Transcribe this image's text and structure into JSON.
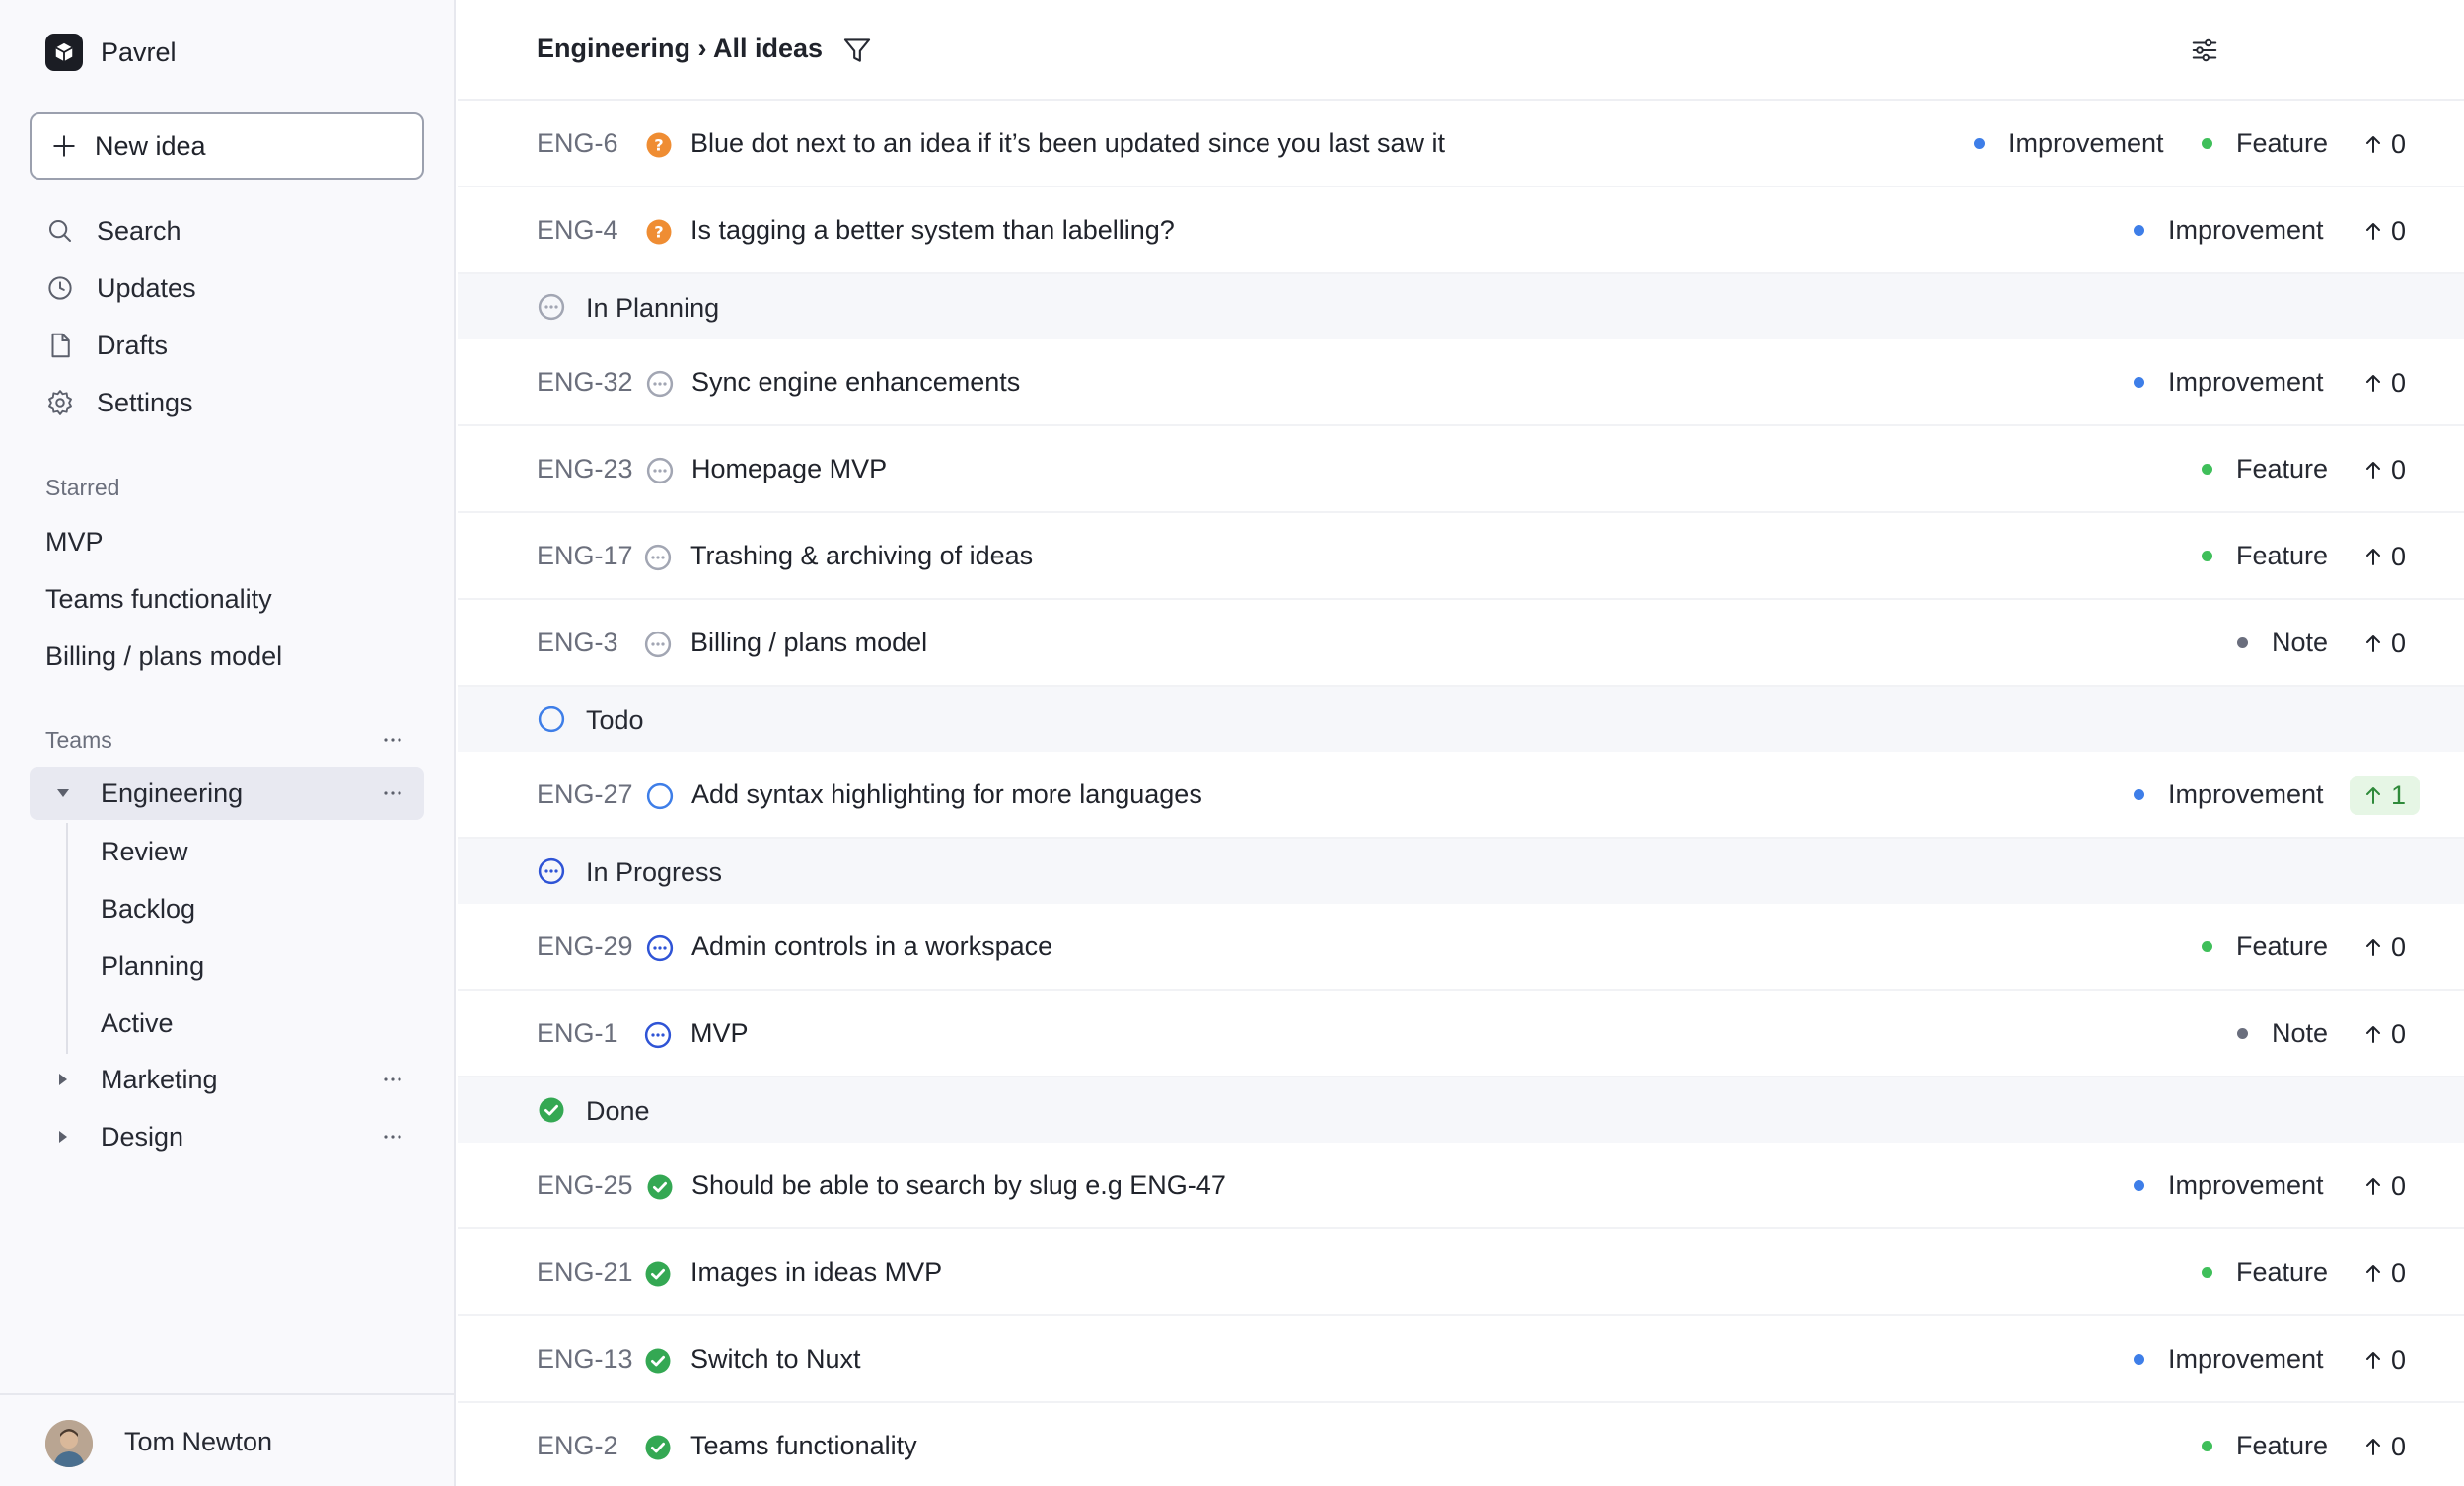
{
  "workspace": {
    "name": "Pavrel"
  },
  "sidebar": {
    "new_idea_label": "New idea",
    "nav": [
      {
        "label": "Search",
        "icon": "search-icon"
      },
      {
        "label": "Updates",
        "icon": "clock-icon"
      },
      {
        "label": "Drafts",
        "icon": "document-icon"
      },
      {
        "label": "Settings",
        "icon": "gear-icon"
      }
    ],
    "starred_title": "Starred",
    "starred": [
      "MVP",
      "Teams functionality",
      "Billing / plans model"
    ],
    "teams_title": "Teams",
    "teams": [
      {
        "label": "Engineering",
        "expanded": true,
        "active": true
      },
      {
        "label": "Marketing",
        "expanded": false,
        "active": false
      },
      {
        "label": "Design",
        "expanded": false,
        "active": false
      }
    ],
    "engineering_views": [
      "Review",
      "Backlog",
      "Planning",
      "Active"
    ],
    "user": {
      "name": "Tom Newton"
    }
  },
  "header": {
    "breadcrumb_team": "Engineering",
    "breadcrumb_sep": " › ",
    "breadcrumb_view": "All ideas"
  },
  "colors": {
    "improvement": "#3e7ee8",
    "feature": "#3fbf5a",
    "note": "#6a6e7d",
    "review_status": "#ef8d33",
    "planning_status": "#a2a6b3",
    "todo_status": "#3e7ee8",
    "progress_status": "#2f54d6",
    "done_status": "#34a853"
  },
  "groups": {
    "planning": "In Planning",
    "todo": "Todo",
    "progress": "In Progress",
    "done": "Done"
  },
  "ideas": [
    {
      "slug": "ENG-6",
      "title": "Blue dot next to an idea if it’s been updated since you last saw it",
      "labels": [
        "Improvement",
        "Feature"
      ],
      "votes": "0"
    },
    {
      "slug": "ENG-4",
      "title": "Is tagging a better system than labelling?",
      "labels": [
        "Improvement"
      ],
      "votes": "0"
    },
    {
      "slug": "ENG-32",
      "title": "Sync engine enhancements",
      "labels": [
        "Improvement"
      ],
      "votes": "0"
    },
    {
      "slug": "ENG-23",
      "title": "Homepage MVP",
      "labels": [
        "Feature"
      ],
      "votes": "0"
    },
    {
      "slug": "ENG-17",
      "title": "Trashing & archiving of ideas",
      "labels": [
        "Feature"
      ],
      "votes": "0"
    },
    {
      "slug": "ENG-3",
      "title": "Billing / plans model",
      "labels": [
        "Note"
      ],
      "votes": "0"
    },
    {
      "slug": "ENG-27",
      "title": "Add syntax highlighting for more languages",
      "labels": [
        "Improvement"
      ],
      "votes": "1"
    },
    {
      "slug": "ENG-29",
      "title": "Admin controls in a workspace",
      "labels": [
        "Feature"
      ],
      "votes": "0"
    },
    {
      "slug": "ENG-1",
      "title": "MVP",
      "labels": [
        "Note"
      ],
      "votes": "0"
    },
    {
      "slug": "ENG-25",
      "title": "Should be able to search by slug e.g ENG-47",
      "labels": [
        "Improvement"
      ],
      "votes": "0"
    },
    {
      "slug": "ENG-21",
      "title": "Images in ideas MVP",
      "labels": [
        "Feature"
      ],
      "votes": "0"
    },
    {
      "slug": "ENG-13",
      "title": "Switch to Nuxt",
      "labels": [
        "Improvement"
      ],
      "votes": "0"
    },
    {
      "slug": "ENG-2",
      "title": "Teams functionality",
      "labels": [
        "Feature"
      ],
      "votes": "0"
    }
  ]
}
